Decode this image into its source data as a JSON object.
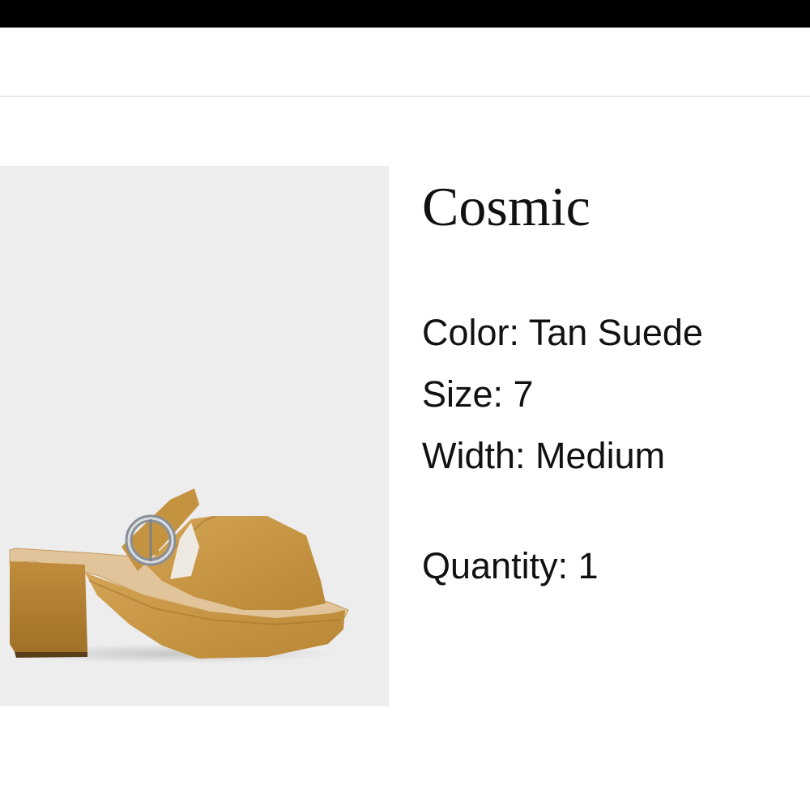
{
  "product": {
    "name": "Cosmic",
    "image_alt": "Tan suede platform mule sandal with buckle strap",
    "color_label": "Color: Tan Suede",
    "size_label": "Size: 7",
    "width_label": "Width: Medium",
    "quantity_label": "Quantity: 1"
  },
  "colors": {
    "top_bar": "#000000",
    "image_background": "#ededee",
    "divider": "#e6e6ef",
    "shoe_tan": "#c99a4a"
  }
}
